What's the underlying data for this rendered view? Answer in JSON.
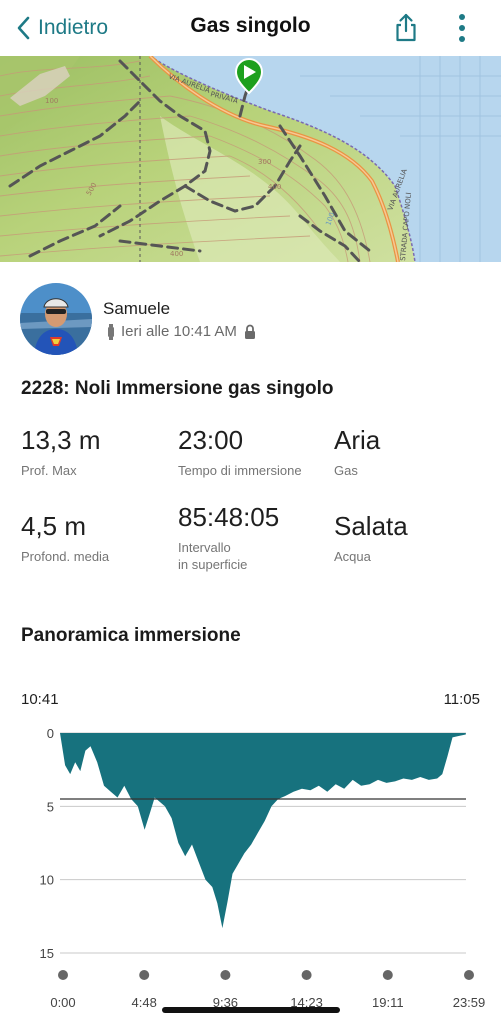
{
  "nav": {
    "back_label": "Indietro",
    "title": "Gas singolo",
    "accent": "#1e7a86"
  },
  "map": {
    "roads": [
      "VIA AURELIA",
      "PRIVATA",
      "VIA AURELIA",
      "STRADA CAPO NOLI"
    ],
    "contours": [
      "100",
      "300",
      "400",
      "500",
      "100",
      "400"
    ],
    "start_marker_color": "#1ea01e"
  },
  "user": {
    "name": "Samuele",
    "time": "Ieri alle 10:41 AM"
  },
  "activity": {
    "title": "2228: Noli Immersione gas singolo"
  },
  "stats": [
    {
      "value": "13,3 m",
      "label": "Prof. Max"
    },
    {
      "value": "23:00",
      "label": "Tempo di immersione"
    },
    {
      "value": "Aria",
      "label": "Gas"
    },
    {
      "value": "4,5 m",
      "label": "Profond. media"
    },
    {
      "value": "85:48:05",
      "label": "Intervallo\nin superficie"
    },
    {
      "value": "Salata",
      "label": "Acqua"
    }
  ],
  "overview": {
    "title": "Panoramica immersione",
    "start_time": "10:41",
    "end_time": "11:05"
  },
  "chart_data": {
    "type": "area",
    "series_color": "#17727e",
    "y_ticks": [
      "0",
      "5",
      "10",
      "15"
    ],
    "ylim": [
      0,
      15
    ],
    "y_inverted": true,
    "x_ticks": [
      "0:00",
      "4:48",
      "9:36",
      "14:23",
      "19:11",
      "23:59"
    ],
    "x_minutes_range": [
      0,
      24
    ],
    "reference_line_depth": 4.5,
    "x_minutes": [
      0,
      0.3,
      0.6,
      0.9,
      1.2,
      1.5,
      1.8,
      2.2,
      2.6,
      3.0,
      3.4,
      3.8,
      4.2,
      4.6,
      5.0,
      5.3,
      5.6,
      5.9,
      6.2,
      6.6,
      7.0,
      7.4,
      7.8,
      8.2,
      8.6,
      9.0,
      9.3,
      9.6,
      9.9,
      10.2,
      10.5,
      10.9,
      11.3,
      11.7,
      12.1,
      12.5,
      12.9,
      13.3,
      13.8,
      14.3,
      14.8,
      15.3,
      15.8,
      16.3,
      16.8,
      17.3,
      17.8,
      18.3,
      18.8,
      19.3,
      19.8,
      20.3,
      20.8,
      21.3,
      21.8,
      22.3,
      22.6,
      22.9,
      23.2,
      23.6,
      23.99
    ],
    "depth_m": [
      0.0,
      2.2,
      2.8,
      2.0,
      2.6,
      1.2,
      0.9,
      2.0,
      3.6,
      4.0,
      4.4,
      3.6,
      4.5,
      5.0,
      6.6,
      5.5,
      4.4,
      4.7,
      5.0,
      5.8,
      7.5,
      8.4,
      7.6,
      8.8,
      10.0,
      10.5,
      11.6,
      13.3,
      11.5,
      9.6,
      9.0,
      8.2,
      7.6,
      6.8,
      6.0,
      5.0,
      4.5,
      4.3,
      4.0,
      3.8,
      3.9,
      3.6,
      4.0,
      3.5,
      3.8,
      3.2,
      3.6,
      3.5,
      3.2,
      3.4,
      3.3,
      3.1,
      3.2,
      3.0,
      3.2,
      3.1,
      2.8,
      1.6,
      0.3,
      0.2,
      0.1
    ]
  }
}
